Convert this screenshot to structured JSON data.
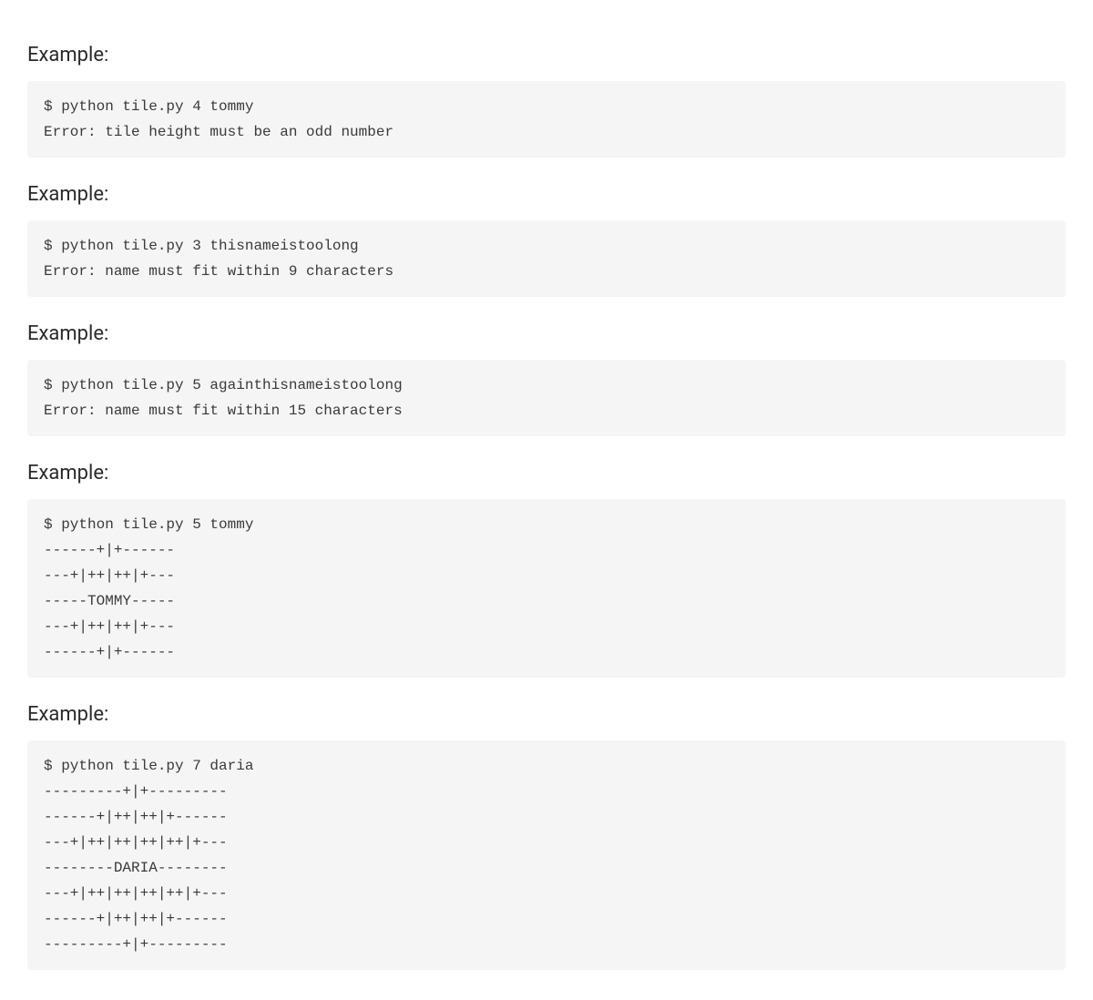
{
  "heading_label": "Example:",
  "examples": [
    {
      "code": "$ python tile.py 4 tommy\nError: tile height must be an odd number"
    },
    {
      "code": "$ python tile.py 3 thisnameistoolong\nError: name must fit within 9 characters"
    },
    {
      "code": "$ python tile.py 5 againthisnameistoolong\nError: name must fit within 15 characters"
    },
    {
      "code": "$ python tile.py 5 tommy\n------+|+------\n---+|++|++|+---\n-----TOMMY-----\n---+|++|++|+---\n------+|+------"
    },
    {
      "code": "$ python tile.py 7 daria\n---------+|+---------\n------+|++|++|+------\n---+|++|++|++|++|+---\n--------DARIA--------\n---+|++|++|++|++|+---\n------+|++|++|+------\n---------+|+---------"
    }
  ]
}
